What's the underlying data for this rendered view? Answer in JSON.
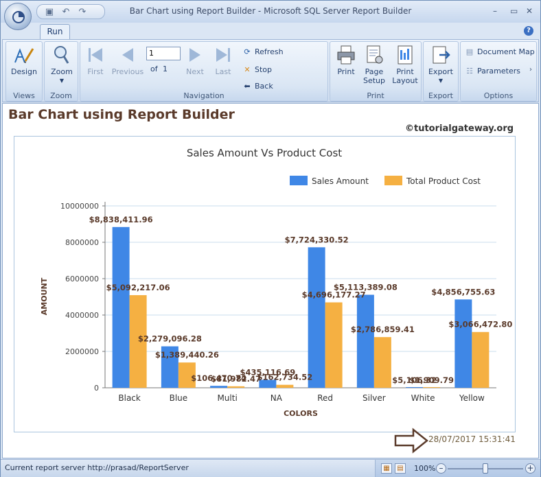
{
  "window": {
    "title": "Bar Chart using Report Builder - Microsoft SQL Server Report Builder",
    "minimize": "–",
    "maximize": "▭",
    "close": "✕"
  },
  "ribbon": {
    "tab": "Run",
    "groups": {
      "views": {
        "label": "Views",
        "design": "Design"
      },
      "zoom": {
        "label": "Zoom",
        "zoom": "Zoom"
      },
      "navigation": {
        "label": "Navigation",
        "first": "First",
        "previous": "Previous",
        "page_value": "1",
        "of": "of",
        "total_pages": "1",
        "next": "Next",
        "last": "Last",
        "refresh": "Refresh",
        "stop": "Stop",
        "back": "Back"
      },
      "print": {
        "label": "Print",
        "print": "Print",
        "page_setup_1": "Page",
        "page_setup_2": "Setup",
        "print_layout_1": "Print",
        "print_layout_2": "Layout"
      },
      "export": {
        "label": "Export",
        "export": "Export"
      },
      "options": {
        "label": "Options",
        "document_map": "Document Map",
        "parameters": "Parameters"
      }
    }
  },
  "report": {
    "title": "Bar Chart using Report Builder",
    "copyright": "©tutorialgateway.org",
    "timestamp": "28/07/2017 15:31:41"
  },
  "chart_data": {
    "type": "bar",
    "title": "Sales Amount Vs Product Cost",
    "xlabel": "COLORS",
    "ylabel": "AMOUNT",
    "ylim": [
      0,
      10000000
    ],
    "yticks": [
      "0",
      "2000000",
      "4000000",
      "6000000",
      "8000000",
      "10000000"
    ],
    "legend_position": "top-right",
    "grid": true,
    "categories": [
      "Black",
      "Blue",
      "Multi",
      "NA",
      "Red",
      "Silver",
      "White",
      "Yellow"
    ],
    "series": [
      {
        "name": "Sales Amount",
        "color": "#3f87e6",
        "values": [
          8838411.96,
          2279096.28,
          106470.74,
          435116.69,
          7724330.52,
          5113389.08,
          5106.32,
          4856755.63
        ],
        "labels": [
          "$8,838,411.96",
          "$2,279,096.28",
          "$106,470.74",
          "$435,116.69",
          "$7,724,330.52",
          "$5,113,389.08",
          "$5,106.32",
          "$4,856,755.63"
        ]
      },
      {
        "name": "Total Product Cost",
        "color": "#f5b042",
        "values": [
          5092217.06,
          1389440.26,
          81982.47,
          162734.52,
          4696177.27,
          2786859.41,
          1909.79,
          3066472.8
        ],
        "labels": [
          "$5,092,217.06",
          "$1,389,440.26",
          "$81,982.47",
          "$162,734.52",
          "$4,696,177.27",
          "$2,786,859.41",
          "$1,909.79",
          "$3,066,472.80"
        ]
      }
    ]
  },
  "statusbar": {
    "server": "Current report server http://prasad/ReportServer",
    "zoom": "100%",
    "zoom_level": 0.5
  }
}
